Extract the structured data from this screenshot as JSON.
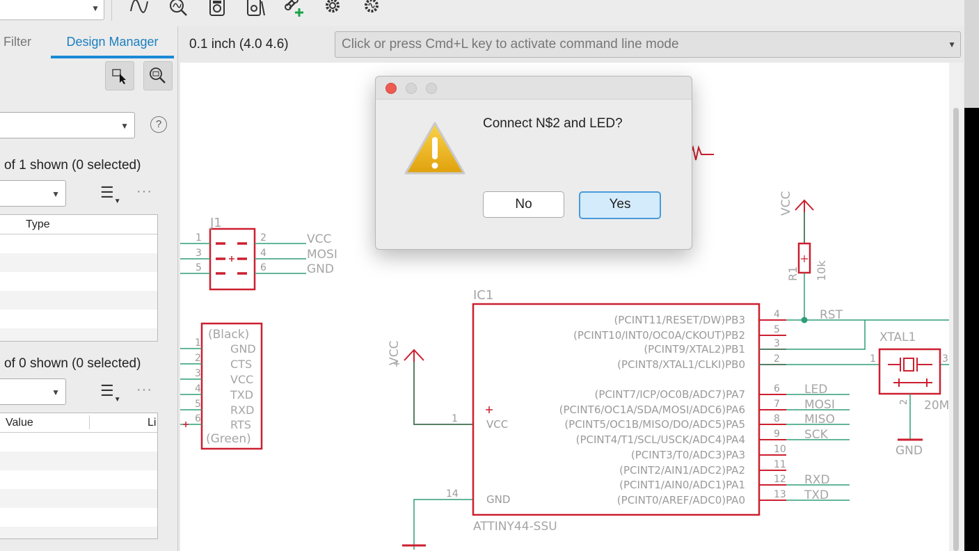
{
  "left_panel": {
    "tab_filter": "Filter",
    "tab_design_manager": "Design Manager",
    "upper_count": "of 1 shown (0 selected)",
    "upper_header_type": "Type",
    "lower_count": "of 0 shown (0 selected)",
    "lower_header_value": "Value",
    "lower_header_li": "Li",
    "help": "?"
  },
  "topbar": {
    "grid_label": "0.1 inch (4.0 4.6)",
    "command_placeholder": "Click or press Cmd+L key to activate command line mode"
  },
  "schematic": {
    "j1": {
      "ref": "J1",
      "pins": [
        "1",
        "2",
        "3",
        "4",
        "5",
        "6"
      ],
      "nets": [
        "VCC",
        "MOSI",
        "GND"
      ]
    },
    "ftdi": {
      "top": "(Black)",
      "bottom": "(Green)",
      "pins": [
        "1",
        "2",
        "3",
        "4",
        "5",
        "6"
      ],
      "signals": [
        "GND",
        "CTS",
        "VCC",
        "TXD",
        "RXD",
        "RTS"
      ]
    },
    "ic1": {
      "ref": "IC1",
      "value": "ATTINY44-SSU",
      "left_pins": [
        {
          "num": "1",
          "name": "VCC"
        },
        {
          "num": "14",
          "name": "GND"
        }
      ],
      "right_pins": [
        {
          "label": "(PCINT11/RESET/DW)PB3",
          "num": "4",
          "net": "RST"
        },
        {
          "label": "(PCINT10/INT0/OC0A/CKOUT)PB2",
          "num": "5",
          "net": ""
        },
        {
          "label": "(PCINT9/XTAL2)PB1",
          "num": "3",
          "net": ""
        },
        {
          "label": "(PCINT8/XTAL1/CLKI)PB0",
          "num": "2",
          "net": ""
        },
        {
          "label": "(PCINT7/ICP/OC0B/ADC7)PA7",
          "num": "6",
          "net": "LED"
        },
        {
          "label": "(PCINT6/OC1A/SDA/MOSI/ADC6)PA6",
          "num": "7",
          "net": "MOSI"
        },
        {
          "label": "(PCINT5/OC1B/MISO/DO/ADC5)PA5",
          "num": "8",
          "net": "MISO"
        },
        {
          "label": "(PCINT4/T1/SCL/USCK/ADC4)PA4",
          "num": "9",
          "net": "SCK"
        },
        {
          "label": "(PCINT3/T0/ADC3)PA3",
          "num": "10",
          "net": ""
        },
        {
          "label": "(PCINT2/AIN1/ADC2)PA2",
          "num": "11",
          "net": ""
        },
        {
          "label": "(PCINT1/AIN0/ADC1)PA1",
          "num": "12",
          "net": "RXD"
        },
        {
          "label": "(PCINT0/AREF/ADC0)PA0",
          "num": "13",
          "net": "TXD"
        }
      ]
    },
    "r1": {
      "ref": "R1",
      "value": "10k"
    },
    "xtal": {
      "ref": "XTAL1",
      "value": "20M",
      "pins": [
        "1",
        "2",
        "3"
      ]
    },
    "supplies": {
      "vcc": "VCC",
      "gnd": "GND"
    }
  },
  "dialog": {
    "message": "Connect N$2 and LED?",
    "no_label": "No",
    "yes_label": "Yes"
  },
  "colors": {
    "accent": "#1a8ad6",
    "part_red": "#cc1f2f",
    "wire_green": "#2e9e77",
    "junction": "#2e9e77"
  }
}
